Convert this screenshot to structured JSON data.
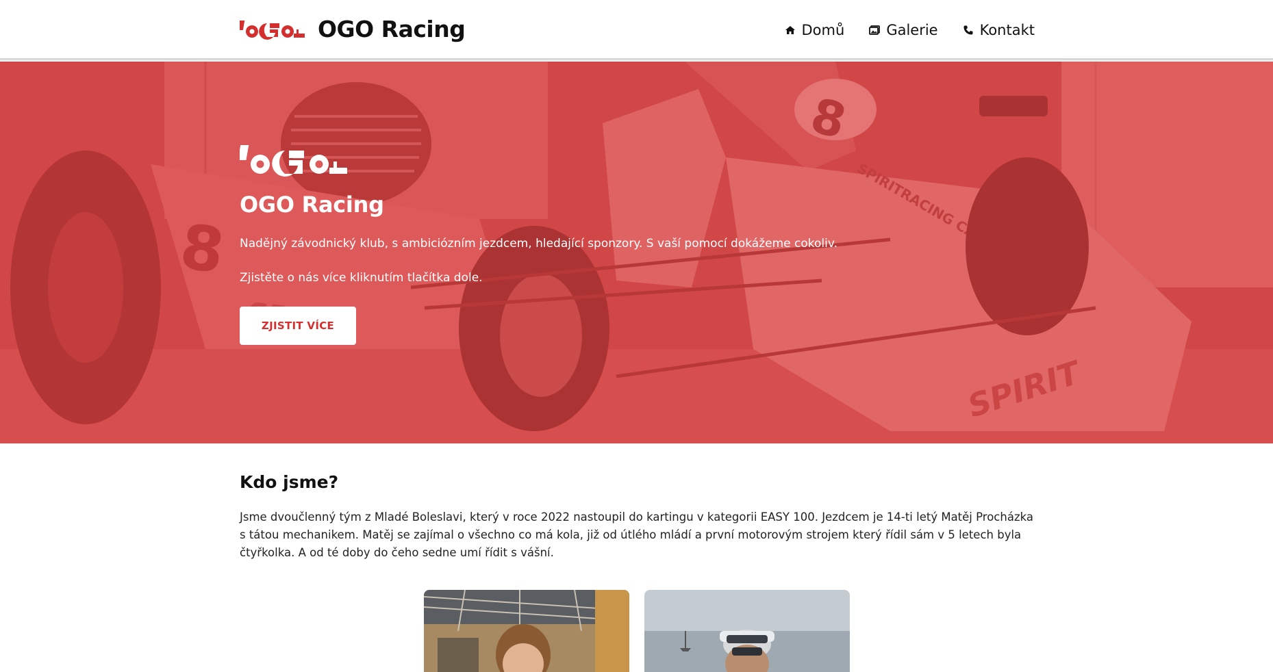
{
  "navbar": {
    "brand": "OGO Racing",
    "items": [
      {
        "label": "Domů",
        "icon": "home-icon"
      },
      {
        "label": "Galerie",
        "icon": "gallery-icon"
      },
      {
        "label": "Kontakt",
        "icon": "phone-icon"
      }
    ]
  },
  "hero": {
    "title": "OGO Racing",
    "text1": "Nadějný závodnický klub, s ambiciózním jezdcem, hledající sponzory. S vaší pomocí dokážeme cokoliv.",
    "text2": "Zjistěte o nás více kliknutím tlačítka dole.",
    "button": "ZJISTIT VÍCE"
  },
  "about": {
    "title": "Kdo jsme?",
    "text": "Jsme dvoučlenný tým z Mladé Boleslavi, který v roce 2022 nastoupil do kartingu v kategorii EASY 100. Jezdcem je 14-ti letý Matěj Procházka s tátou mechanikem. Matěj se zajímal o všechno co má kola, již od útlého mládí a první motorovým strojem který řídil sám v 5 letech byla čtyřkolka. A od té doby do čeho sedne umí řídit s vášní."
  },
  "colors": {
    "accent": "#d32f2f",
    "hero_overlay": "#de4646",
    "text": "#111111"
  }
}
